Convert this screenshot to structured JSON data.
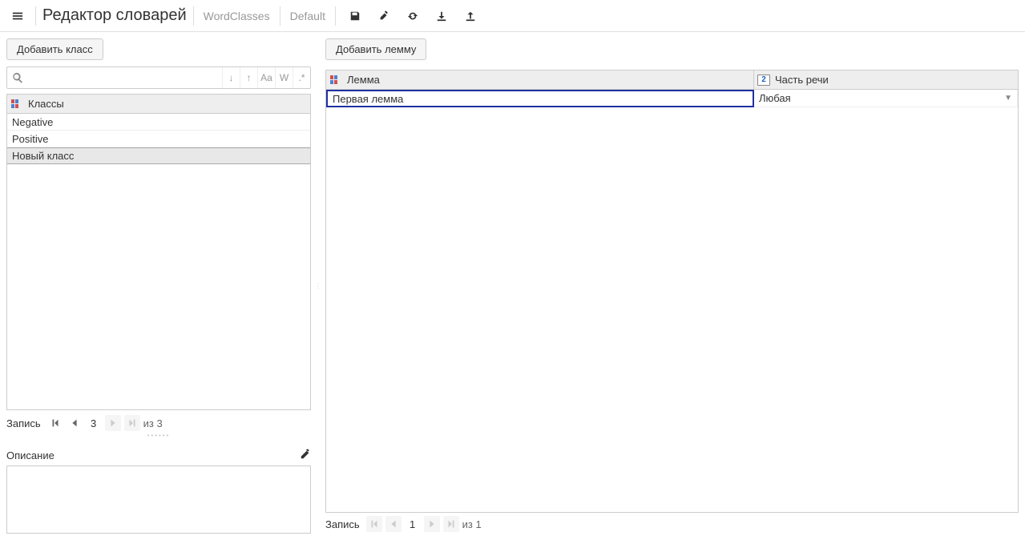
{
  "header": {
    "app_title": "Редактор словарей",
    "crumb1": "WordClasses",
    "crumb2": "Default"
  },
  "left": {
    "add_class_btn": "Добавить класс",
    "search_placeholder": "",
    "sort_tool_down": "↓",
    "sort_tool_up": "↑",
    "tool_aa": "Aa",
    "tool_w": "W",
    "tool_regex": ".*",
    "classes_header": "Классы",
    "rows": [
      {
        "label": "Negative"
      },
      {
        "label": "Positive"
      },
      {
        "label": "Новый класс"
      }
    ],
    "pager": {
      "label": "Запись",
      "page": "3",
      "total": "из 3"
    },
    "desc_title": "Описание"
  },
  "right": {
    "add_lemma_btn": "Добавить лемму",
    "col_lemma": "Лемма",
    "col_pos": "Часть речи",
    "col_pos_badge": "2",
    "rows": [
      {
        "lemma": "Первая лемма",
        "pos": "Любая"
      }
    ],
    "pager": {
      "label": "Запись",
      "page": "1",
      "total": "из 1"
    }
  }
}
